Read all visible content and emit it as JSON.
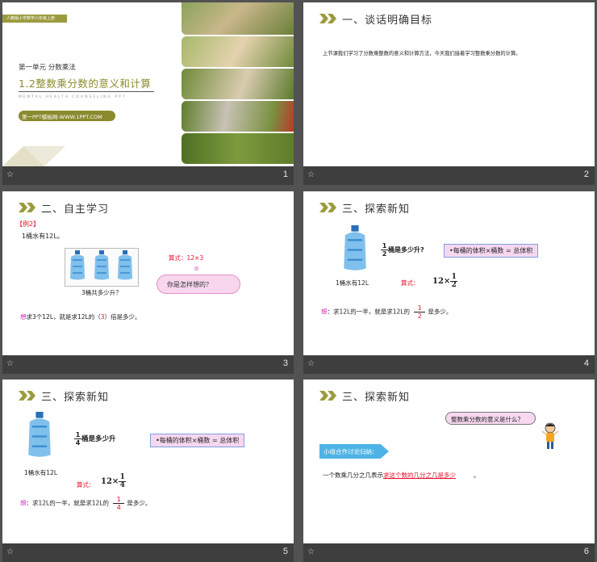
{
  "slides": [
    {
      "num": "1",
      "banner": "人教版小学数学六年级上册",
      "unit": "第一单元   分数乘法",
      "title": "1.2整数乘分数的意义和计算",
      "subtitle": "MENTAL HEALTH COUNSELING PPT",
      "site": "第一PPT模板网-WWW.1PPT.COM"
    },
    {
      "num": "2",
      "heading": "一、谈话明确目标",
      "text": "上节课我们学习了分数乘整数的意义和计算方法，今天我们接着学习整数乘分数的计算。"
    },
    {
      "num": "3",
      "heading": "二、自主学习",
      "example": "【例2】",
      "line1": "1桶水有12L。",
      "formula": "算式：12×3",
      "question": "3桶共多少升？",
      "cloud": "你是怎样想的？",
      "think_mark": "想",
      "think_a": "求3个12L，就是求12L的（",
      "think_ans": "3",
      "think_b": "）倍是多少。"
    },
    {
      "num": "4",
      "heading": "三、探索新知",
      "q_num": "1",
      "q_den": "2",
      "q_text": "桶是多少升?",
      "box": "•每桶的体积×桶数 = 总体积",
      "bottle_label": "1桶水有12L",
      "formula_label": "算式：",
      "expr_int": "12×",
      "expr_num": "1",
      "expr_den": "2",
      "think_mark": "想",
      "think_a": "：求12L的一半，就是求12L的",
      "ans_num": "1",
      "ans_den": "2",
      "think_b": "是多少。"
    },
    {
      "num": "5",
      "heading": "三、探索新知",
      "q_num": "1",
      "q_den": "4",
      "q_text": "桶是多少升",
      "box": "•每桶的体积×桶数 = 总体积",
      "bottle_label": "1桶水有12L",
      "formula_label": "算式：",
      "expr_int": "12×",
      "expr_num": "1",
      "expr_den": "4",
      "think_mark": "想",
      "think_a": "：求12L的一半，就是求12L的",
      "ans_num": "1",
      "ans_den": "4",
      "think_b": "是多少。"
    },
    {
      "num": "6",
      "heading": "三、探索新知",
      "bubble": "整数乘分数的意义是什么？",
      "group_label": "小组合作讨论归纳：",
      "sent_a": "一个数乘几分之几表示",
      "sent_red": "求这个数的几分之几是多少",
      "sent_b": "。"
    }
  ],
  "colors": {
    "accent": "#9b9b3e",
    "title_olive": "#8a8a2e",
    "red": "#e8102a",
    "pink": "#d41fb6",
    "box_fill": "#f6d7f0",
    "button_blue": "#4db3e6"
  }
}
